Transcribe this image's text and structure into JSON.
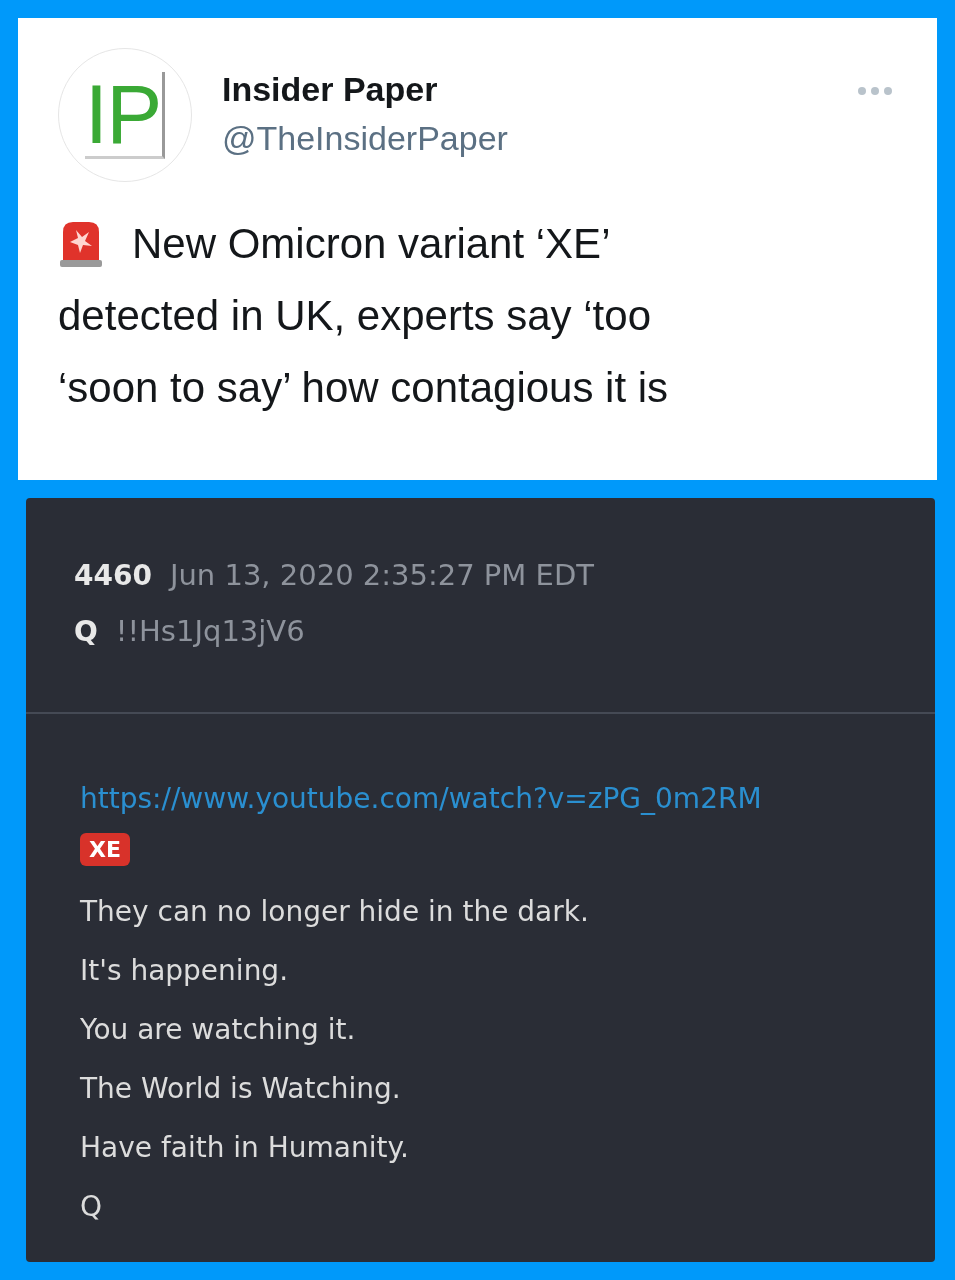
{
  "tweet": {
    "avatar_logo": "IP",
    "name": "Insider Paper",
    "handle": "@TheInsiderPaper",
    "text_lines": [
      "New Omicron variant ‘XE’",
      "detected in UK, experts say ‘too",
      "‘soon to say’ how contagious it is"
    ]
  },
  "post": {
    "number": "4460",
    "date": "Jun 13, 2020 2:35:27 PM EDT",
    "author": "Q",
    "tripcode": "!!Hs1Jq13jV6",
    "link": "https://www.youtube.com/watch?v=zPG_0m2RM",
    "tag": "XE",
    "lines": [
      "They can no longer hide in the dark.",
      "It's happening.",
      "You are watching it.",
      "The World is Watching.",
      "Have faith in Humanity.",
      "Q"
    ]
  }
}
